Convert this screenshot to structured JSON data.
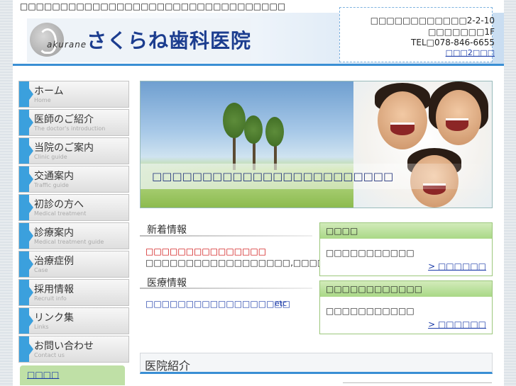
{
  "header": {
    "tagline": "□□□□□□□□□□□□□□□□□□□□□□□□□□□□□□□□□",
    "logo_subtext": "akurane",
    "clinic_name": "さくらね歯科医院",
    "address_line1": "□□□□□□□□□□□□2-2-10",
    "address_line2": "□□□□□□□1F",
    "tel": "TEL□078-846-6655",
    "map_link": "□□□2□□□"
  },
  "nav": {
    "items": [
      {
        "label": "ホーム",
        "sub": "Home"
      },
      {
        "label": "医師のご紹介",
        "sub": "The doctor's introduction"
      },
      {
        "label": "当院のご案内",
        "sub": "Clinic guide"
      },
      {
        "label": "交通案内",
        "sub": "Traffic guide"
      },
      {
        "label": "初診の方へ",
        "sub": "Medical treatment"
      },
      {
        "label": "診療案内",
        "sub": "Medical treatment guide"
      },
      {
        "label": "治療症例",
        "sub": "Case"
      },
      {
        "label": "採用情報",
        "sub": "Recruit info"
      },
      {
        "label": "リンク集",
        "sub": "Links"
      },
      {
        "label": "お問い合わせ",
        "sub": "Contact us"
      }
    ],
    "bottom_link": "□□□□"
  },
  "hero": {
    "caption": "□□□□□□□□□□□□□□□□□□□□□□□□"
  },
  "news": {
    "title": "新着情報",
    "highlight": "□□□□□□□□□□□□□□□",
    "text": "□□□□□□□□□□□□□□□□□□,□□□□□□□□□□□□"
  },
  "medical": {
    "title": "医療情報",
    "link": "□□□□□□□□□□□□□□□□□□",
    "etc": "etc"
  },
  "box1": {
    "heading": "□□□□",
    "text": "□□□□□□□□□□□",
    "more": "> □□□□□□"
  },
  "box2": {
    "heading": "□□□□□□□□□□□□",
    "text": "□□□□□□□□□□□",
    "more": "> □□□□□□"
  },
  "intro": {
    "title": "医院紹介"
  },
  "colors": {
    "accent_blue": "#3a8fd4",
    "brand_navy": "#1c3d8f",
    "box_green": "#a9d886",
    "alert_red": "#cc0000"
  }
}
